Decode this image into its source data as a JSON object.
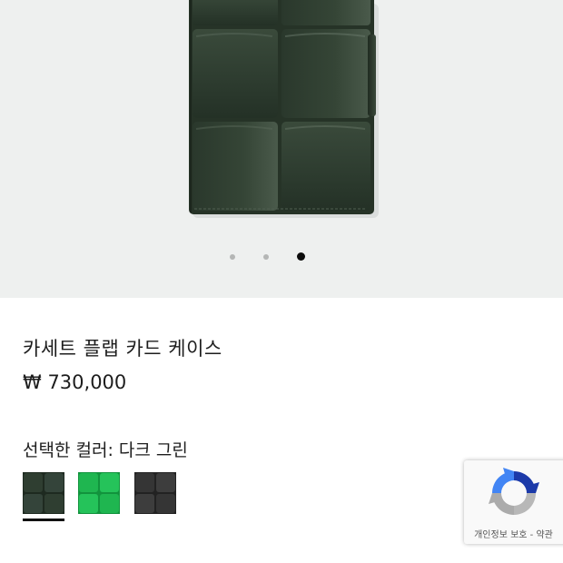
{
  "product": {
    "title": "카세트 플랩 카드 케이스",
    "price": "₩ 730,000",
    "selected_color_label": "선택한 컬러: 다크 그린"
  },
  "carousel": {
    "total_slides": 3,
    "active_index": 2
  },
  "swatches": [
    {
      "name": "dark-green",
      "color": "#26352a",
      "selected": true
    },
    {
      "name": "bright-green",
      "color": "#1fb650",
      "selected": false
    },
    {
      "name": "black",
      "color": "#353535",
      "selected": false
    }
  ],
  "recaptcha": {
    "privacy_label": "개인정보 보호",
    "separator": " - ",
    "terms_label": "약관"
  },
  "colors": {
    "hero_background": "#eef0ef",
    "wallet_leather": "#2d3a2e",
    "accent_text": "#1d1d1d"
  },
  "icons": {
    "recaptcha": "recaptcha-logo-icon"
  }
}
